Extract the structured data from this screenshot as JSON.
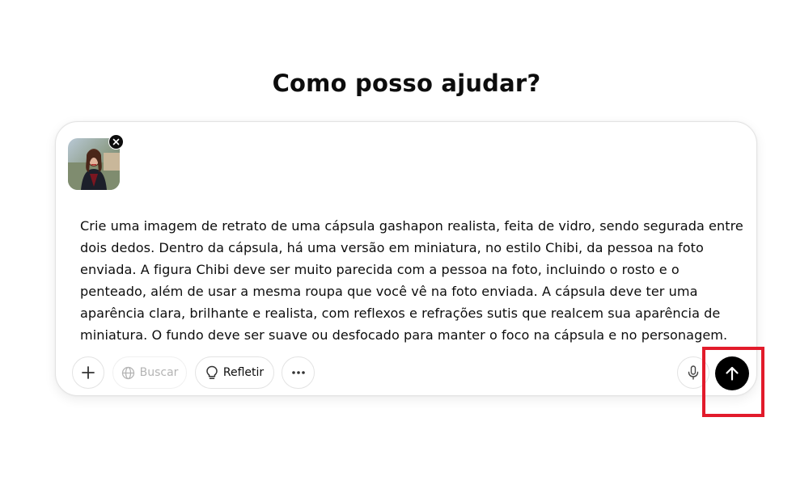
{
  "heading": "Como posso ajudar?",
  "composer": {
    "attachment": {
      "icon": "image-thumbnail",
      "remove_icon": "close-icon"
    },
    "prompt_text": "Crie uma imagem de retrato de uma cápsula gashapon realista, feita de vidro, sendo segurada entre dois dedos. Dentro da cápsula, há uma versão em miniatura, no estilo Chibi, da pessoa na foto enviada. A figura Chibi deve ser muito parecida com a pessoa na foto, incluindo o rosto e o penteado, além de usar a mesma roupa que você vê na foto enviada. A cápsula deve ter uma aparência clara, brilhante e realista, com reflexos e refrações sutis que realcem sua aparência de miniatura. O fundo deve ser suave ou desfocado para manter o foco na cápsula e no personagem."
  },
  "toolbar": {
    "add_icon": "plus-icon",
    "search_label": "Buscar",
    "search_icon": "globe-icon",
    "think_label": "Refletir",
    "think_icon": "lightbulb-icon",
    "more_icon": "ellipsis-icon",
    "mic_icon": "microphone-icon",
    "send_icon": "arrow-up-icon"
  },
  "colors": {
    "accent": "#000000",
    "highlight": "#e21b2b",
    "border": "#e3e3e3",
    "disabled_text": "#b4b4b4"
  }
}
